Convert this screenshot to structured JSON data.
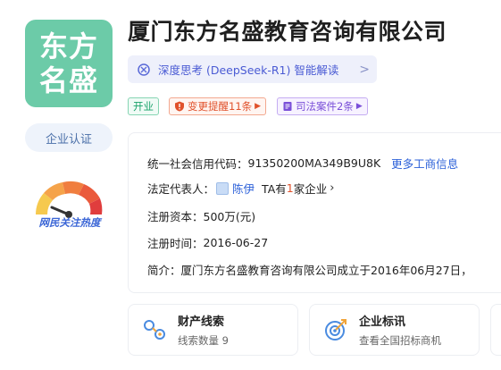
{
  "company": {
    "logo_line1": "东方",
    "logo_line2": "名盛",
    "name": "厦门东方名盛教育咨询有限公司"
  },
  "ai_summary": {
    "label": "深度思考 (DeepSeek-R1) 智能解读",
    "chevron": ">"
  },
  "tags": {
    "status": "开业",
    "change_alert": "变更提醒11条",
    "legal_cases": "司法案件2条"
  },
  "certification": {
    "label": "企业认证"
  },
  "attention": {
    "label": "网民关注热度"
  },
  "info": {
    "credit_code_label": "统一社会信用代码：",
    "credit_code_value": "91350200MA349B9U8K",
    "more_link": "更多工商信息",
    "legal_rep_label": "法定代表人：",
    "legal_rep_name": "陈伊",
    "legal_rep_prefix": "TA有",
    "legal_rep_count": "1",
    "legal_rep_suffix": "家企业",
    "capital_label": "注册资本：",
    "capital_value": "500万(元)",
    "reg_time_label": "注册时间：",
    "reg_time_value": "2016-06-27",
    "intro_label": "简介：",
    "intro_value": "厦门东方名盛教育咨询有限公司成立于2016年06月27日，"
  },
  "tiles": [
    {
      "title": "财产线索",
      "subtitle": "线索数量 9"
    },
    {
      "title": "企业标讯",
      "subtitle": "查看全国招标商机"
    }
  ],
  "colors": {
    "logo_bg": "#6ccba8",
    "link_blue": "#2e62d9",
    "alert_red": "#e0512b",
    "legal_purple": "#7a4fd8",
    "status_green": "#1aa36b"
  }
}
